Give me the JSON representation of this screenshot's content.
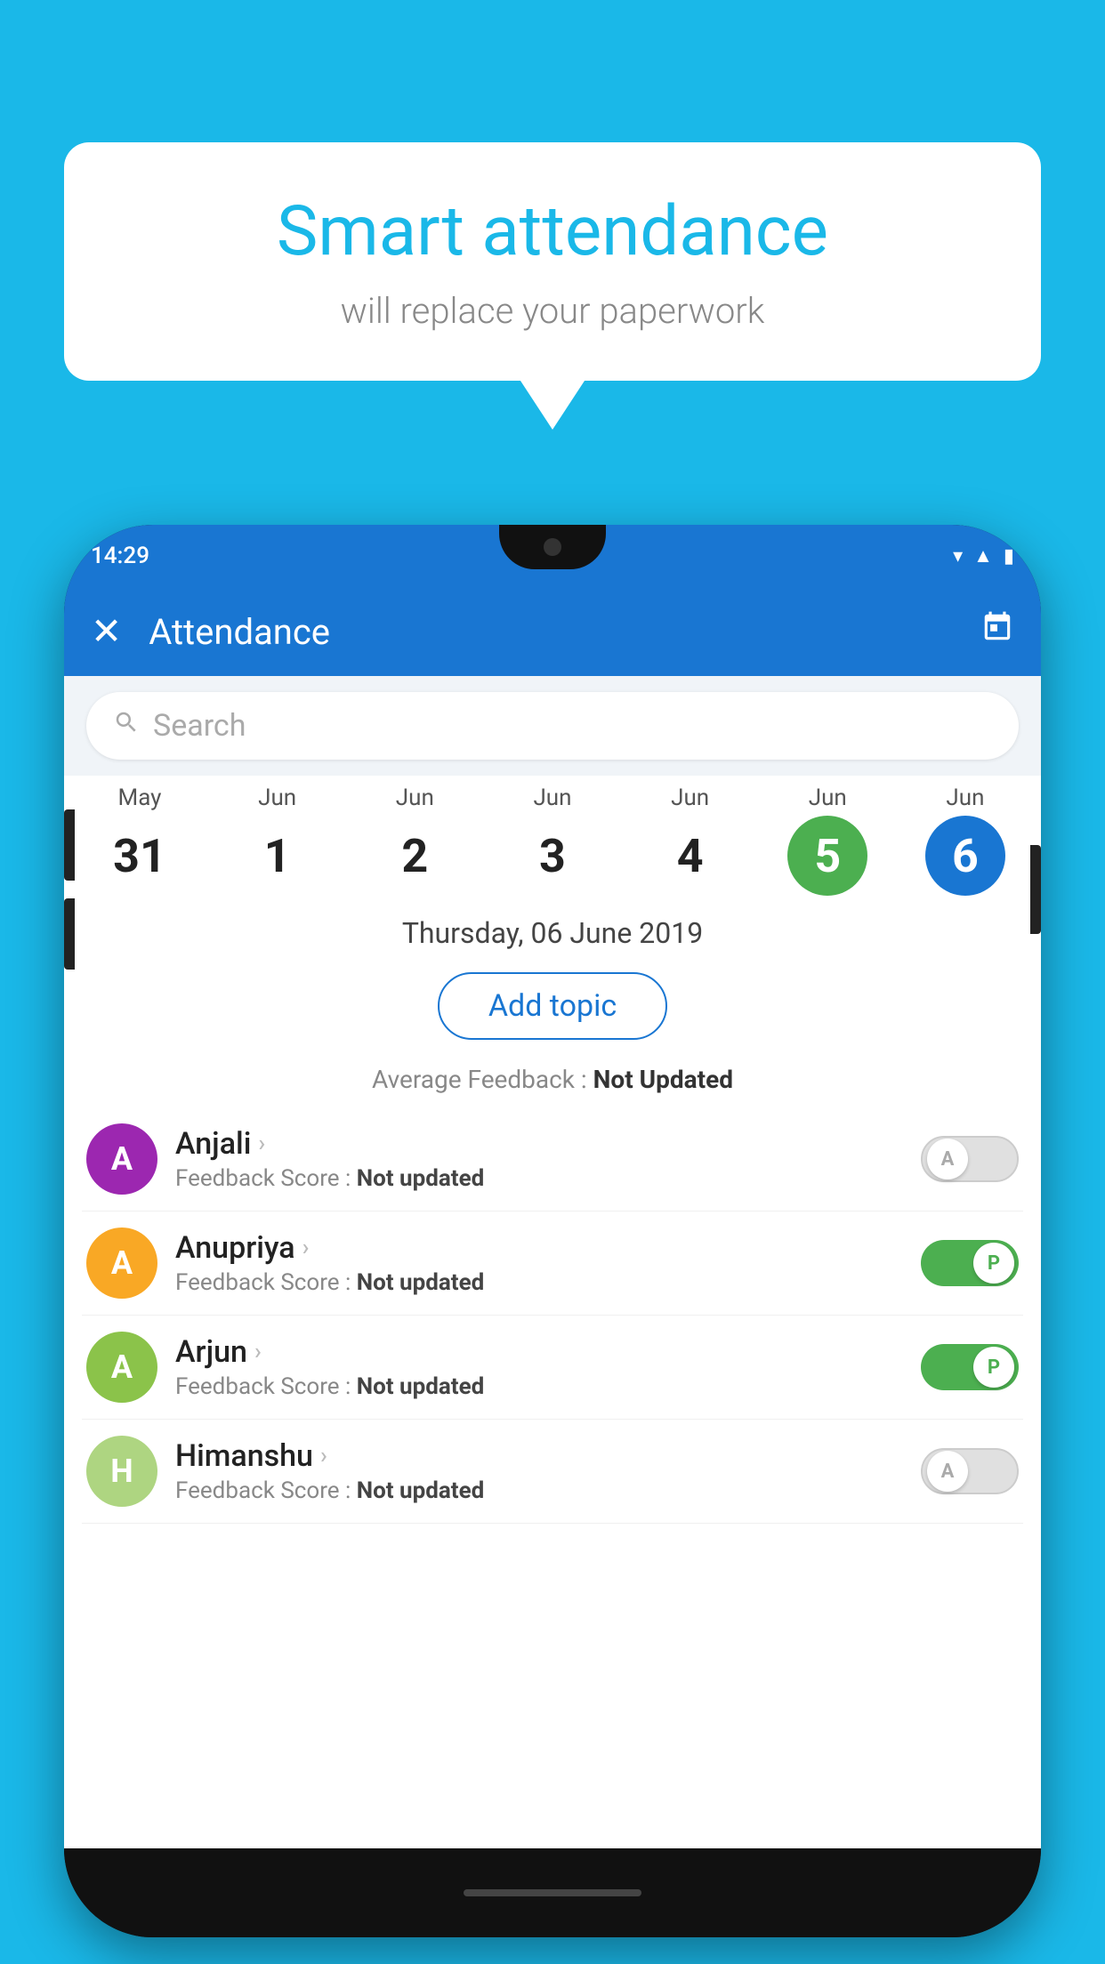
{
  "background_color": "#1ab8e8",
  "speech_bubble": {
    "title": "Smart attendance",
    "subtitle": "will replace your paperwork"
  },
  "status_bar": {
    "time": "14:29",
    "icons": [
      "wifi",
      "signal",
      "battery"
    ]
  },
  "app_bar": {
    "title": "Attendance",
    "close_label": "✕",
    "calendar_icon": "📅"
  },
  "search": {
    "placeholder": "Search"
  },
  "calendar": {
    "dates": [
      {
        "month": "May",
        "day": "31",
        "style": "normal"
      },
      {
        "month": "Jun",
        "day": "1",
        "style": "normal"
      },
      {
        "month": "Jun",
        "day": "2",
        "style": "normal"
      },
      {
        "month": "Jun",
        "day": "3",
        "style": "normal"
      },
      {
        "month": "Jun",
        "day": "4",
        "style": "normal"
      },
      {
        "month": "Jun",
        "day": "5",
        "style": "today"
      },
      {
        "month": "Jun",
        "day": "6",
        "style": "selected"
      }
    ],
    "selected_date_label": "Thursday, 06 June 2019"
  },
  "add_topic_button": "Add topic",
  "average_feedback": {
    "label": "Average Feedback :",
    "value": "Not Updated"
  },
  "students": [
    {
      "name": "Anjali",
      "avatar_letter": "A",
      "avatar_color": "#9c27b0",
      "feedback_label": "Feedback Score :",
      "feedback_value": "Not updated",
      "toggle_state": "off",
      "toggle_letter": "A"
    },
    {
      "name": "Anupriya",
      "avatar_letter": "A",
      "avatar_color": "#f9a825",
      "feedback_label": "Feedback Score :",
      "feedback_value": "Not updated",
      "toggle_state": "on",
      "toggle_letter": "P"
    },
    {
      "name": "Arjun",
      "avatar_letter": "A",
      "avatar_color": "#8bc34a",
      "feedback_label": "Feedback Score :",
      "feedback_value": "Not updated",
      "toggle_state": "on",
      "toggle_letter": "P"
    },
    {
      "name": "Himanshu",
      "avatar_letter": "H",
      "avatar_color": "#aed581",
      "feedback_label": "Feedback Score :",
      "feedback_value": "Not updated",
      "toggle_state": "off",
      "toggle_letter": "A"
    }
  ]
}
